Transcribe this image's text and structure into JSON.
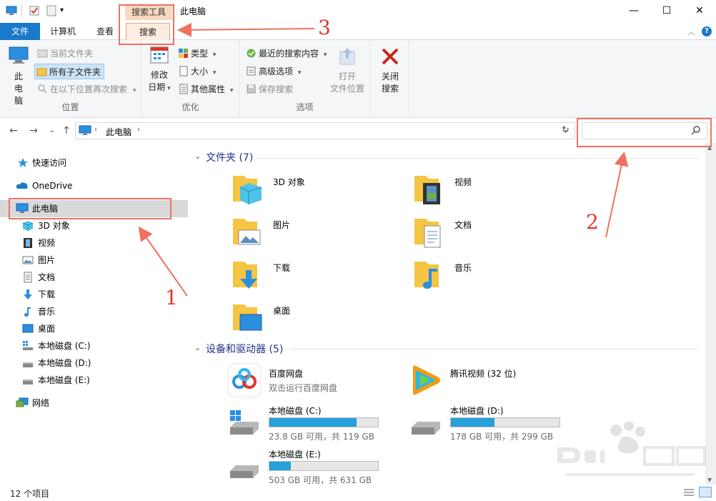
{
  "window": {
    "title": "此电脑",
    "context_tab_group": "搜索工具",
    "minimize": "—",
    "maximize": "☐",
    "close": "✕"
  },
  "tabs": [
    {
      "label": "文件"
    },
    {
      "label": "计算机"
    },
    {
      "label": "查看"
    },
    {
      "label": "搜索"
    }
  ],
  "ribbon": {
    "location_group": {
      "label": "位置",
      "this_pc": "此电脑",
      "current_folder": "当前文件夹",
      "all_subfolders": "所有子文件夹",
      "search_again_in": "在以下位置再次搜索"
    },
    "refine_group": {
      "label": "优化",
      "date_modified_line1": "修改",
      "date_modified_line2": "日期",
      "kind": "类型",
      "size": "大小",
      "other_properties": "其他属性"
    },
    "options_group": {
      "label": "选项",
      "recent_searches": "最近的搜索内容",
      "advanced_options": "高级选项",
      "save_search": "保存搜索",
      "open_file_location_line1": "打开",
      "open_file_location_line2": "文件位置"
    },
    "close_search": {
      "line1": "关闭",
      "line2": "搜索"
    }
  },
  "address": {
    "path": "此电脑",
    "search_placeholder": ""
  },
  "navpane": {
    "items": [
      {
        "label": "快速访问"
      },
      {
        "label": "OneDrive"
      },
      {
        "label": "此电脑"
      },
      {
        "label": "3D 对象"
      },
      {
        "label": "视频"
      },
      {
        "label": "图片"
      },
      {
        "label": "文档"
      },
      {
        "label": "下载"
      },
      {
        "label": "音乐"
      },
      {
        "label": "桌面"
      },
      {
        "label": "本地磁盘 (C:)"
      },
      {
        "label": "本地磁盘 (D:)"
      },
      {
        "label": "本地磁盘 (E:)"
      },
      {
        "label": "网络"
      }
    ]
  },
  "content": {
    "folders_header": "文件夹 (7)",
    "folders": [
      {
        "label": "3D 对象"
      },
      {
        "label": "视频"
      },
      {
        "label": "图片"
      },
      {
        "label": "文档"
      },
      {
        "label": "下载"
      },
      {
        "label": "音乐"
      },
      {
        "label": "桌面"
      }
    ],
    "devices_header": "设备和驱动器 (5)",
    "apps": [
      {
        "label": "百度网盘",
        "sub": "双击运行百度网盘"
      },
      {
        "label": "腾讯视频 (32 位)",
        "sub": ""
      }
    ],
    "drives": [
      {
        "label": "本地磁盘 (C:)",
        "free": "23.8 GB 可用，共 119 GB",
        "used_fraction": 0.8
      },
      {
        "label": "本地磁盘 (D:)",
        "free": "178 GB 可用，共 299 GB",
        "used_fraction": 0.4
      },
      {
        "label": "本地磁盘 (E:)",
        "free": "503 GB 可用，共 631 GB",
        "used_fraction": 0.2
      }
    ]
  },
  "status": {
    "item_count": "12 个项目"
  },
  "annotations": {
    "n1": "1",
    "n2": "2",
    "n3": "3"
  },
  "colors": {
    "accent": "#1979ca",
    "annotation": "#e5322d",
    "drive_bar": "#26a0da"
  }
}
